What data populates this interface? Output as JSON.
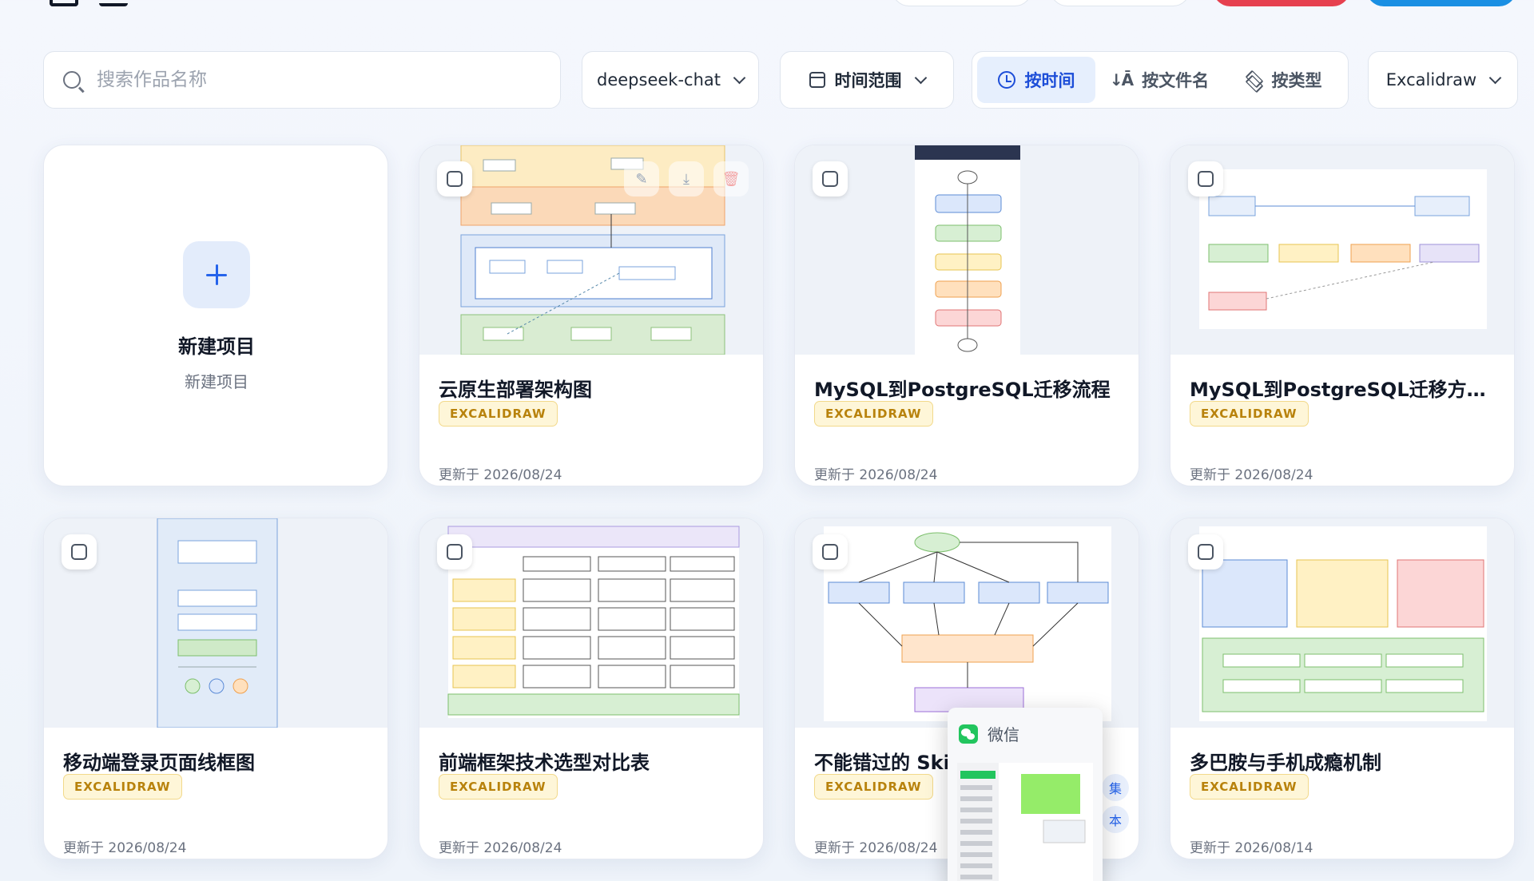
{
  "search": {
    "placeholder": "搜索作品名称",
    "value": ""
  },
  "filters": {
    "model": "deepseek-chat",
    "time_range": "时间范围",
    "sort_options": [
      {
        "label": "按时间",
        "icon": "clock-icon",
        "active": true
      },
      {
        "label": "按文件名",
        "icon": "sort-alpha-icon",
        "active": false
      },
      {
        "label": "按类型",
        "icon": "layers-icon",
        "active": false
      }
    ],
    "editor": "Excalidraw"
  },
  "new_project": {
    "title": "新建项目",
    "subtitle": "新建项目"
  },
  "projects": [
    {
      "title": "云原生部署架构图",
      "type": "EXCALIDRAW",
      "date": "更新于 2026/08/24"
    },
    {
      "title": "MySQL到PostgreSQL迁移流程",
      "type": "EXCALIDRAW",
      "date": "更新于 2026/08/24"
    },
    {
      "title": "MySQL到PostgreSQL迁移方案示...",
      "type": "EXCALIDRAW",
      "date": "更新于 2026/08/24"
    },
    {
      "title": "移动端登录页面线框图",
      "type": "EXCALIDRAW",
      "date": "更新于 2026/08/24"
    },
    {
      "title": "前端框架技术选型对比表",
      "type": "EXCALIDRAW",
      "date": "更新于 2026/08/24"
    },
    {
      "title": "不能错过的 Skil",
      "type": "EXCALIDRAW",
      "date": "更新于 2026/08/24"
    },
    {
      "title": "多巴胺与手机成瘾机制",
      "type": "EXCALIDRAW",
      "date": "更新于 2026/08/14"
    }
  ],
  "wechat_popup": {
    "label": "微信"
  },
  "colors": {
    "accent": "#2563eb",
    "badge_bg": "#fef6d8",
    "badge_text": "#b8820c"
  }
}
